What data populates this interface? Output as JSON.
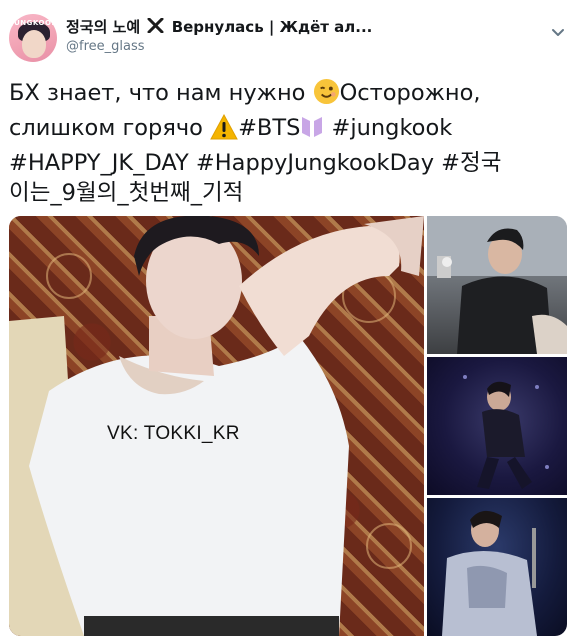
{
  "author": {
    "display_name_part1": "정국의 노예",
    "display_name_part2": "Вернулась | Ждёт ал...",
    "username": "@free_glass",
    "avatar_text": "JUNGKOOK"
  },
  "tweet": {
    "line1_a": "БХ знает, что нам нужно ",
    "line1_b": "Осторожно,",
    "line2_a": "слишком горячо ",
    "line2_b": "#BTS",
    "line2_c": " #jungkook",
    "line3": "#HAPPY_JK_DAY #HappyJungkookDay #정국",
    "line4": "이는_9월의_첫번째_기적"
  },
  "media": {
    "watermark": "VK: TOKKI_KR",
    "images": [
      {
        "name": "main-photo"
      },
      {
        "name": "side-photo-1"
      },
      {
        "name": "side-photo-2"
      },
      {
        "name": "side-photo-3"
      }
    ]
  },
  "icons": {
    "x-mark": "x-mark-icon",
    "winking-face": "winking-face-emoji",
    "warning": "warning-emoji",
    "bts-logo": "bts-logo-emoji",
    "caret": "chevron-down-icon"
  },
  "colors": {
    "text": "#14171a",
    "secondary": "#657786",
    "caret": "#657786"
  }
}
